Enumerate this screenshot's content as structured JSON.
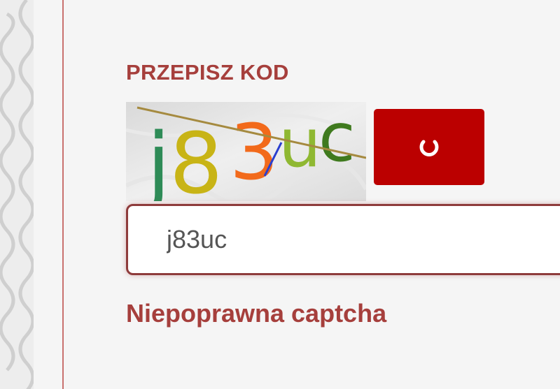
{
  "form": {
    "label": "PRZEPISZ KOD",
    "captcha_text": "j83uc",
    "captcha_glyphs": [
      {
        "char": "j",
        "color": "#2e8b57"
      },
      {
        "char": "8",
        "color": "#c8b416"
      },
      {
        "char": "3",
        "color": "#f26a1b"
      },
      {
        "char": "u",
        "color": "#8fb832"
      },
      {
        "char": "c",
        "color": "#3f7a1e"
      }
    ],
    "refresh_icon": "refresh-icon",
    "refresh_color": "#bb0000",
    "input_value": "j83uc",
    "error_message": "Niepoprawna captcha"
  }
}
